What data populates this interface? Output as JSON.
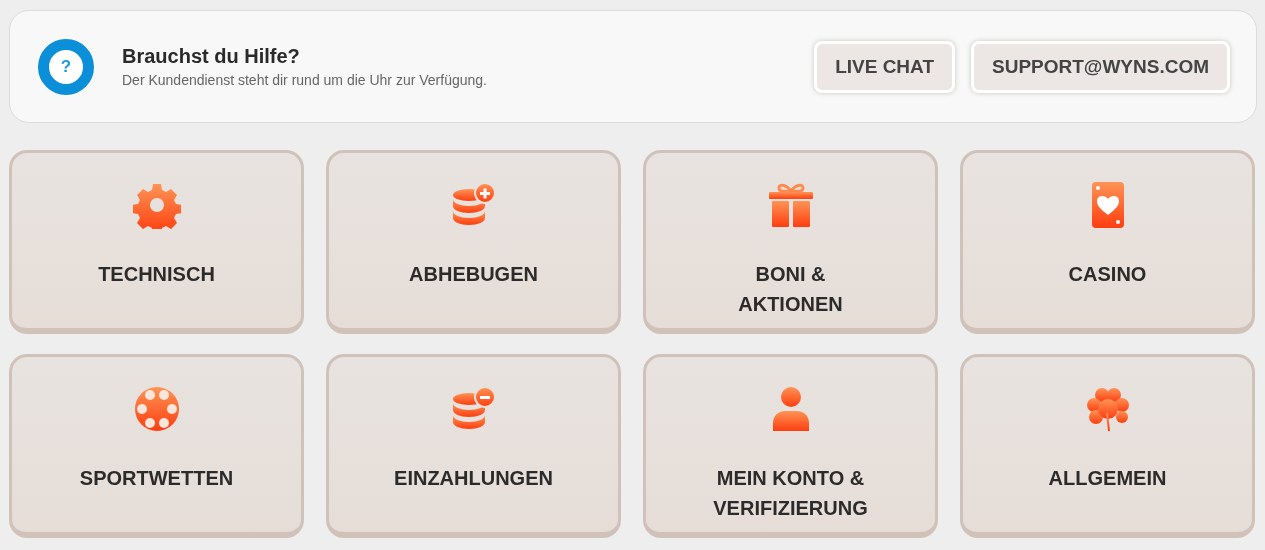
{
  "help": {
    "title": "Brauchst du Hilfe?",
    "subtitle": "Der Kundendienst steht dir rund um die Uhr zur Verfügung.",
    "icon_glyph": "?",
    "buttons": [
      "LIVE CHAT",
      "SUPPORT@WYNS.COM"
    ]
  },
  "categories": [
    {
      "label": "TECHNISCH",
      "kind": "gear"
    },
    {
      "label": "ABHEBUGEN",
      "kind": "coins-plus"
    },
    {
      "label": "BONI & AKTIONEN",
      "kind": "gift"
    },
    {
      "label": "CASINO",
      "kind": "card"
    },
    {
      "label": "SPORTWETTEN",
      "kind": "ball"
    },
    {
      "label": "EINZAHLUNGEN",
      "kind": "coins-minus"
    },
    {
      "label": "MEIN KONTO & VERIFIZIERUNG",
      "kind": "person"
    },
    {
      "label": "ALLGEMEIN",
      "kind": "clover"
    }
  ]
}
